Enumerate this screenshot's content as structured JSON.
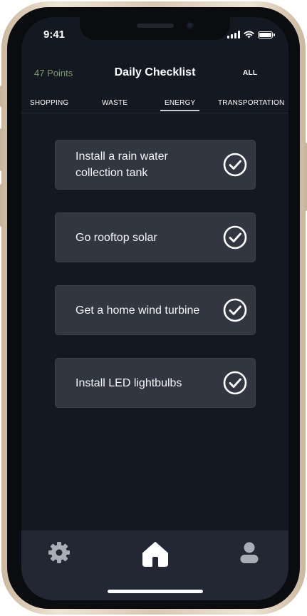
{
  "status_bar": {
    "time": "9:41"
  },
  "header": {
    "points": "47 Points",
    "title": "Daily Checklist",
    "all_label": "ALL"
  },
  "tabs": [
    {
      "label": "SHOPPING",
      "active": false
    },
    {
      "label": "WASTE",
      "active": false
    },
    {
      "label": "ENERGY",
      "active": true
    },
    {
      "label": "TRANSPORTATION",
      "active": false
    }
  ],
  "checklist": [
    {
      "label": "Install a rain water collection tank",
      "icon": "check-circle-icon"
    },
    {
      "label": "Go rooftop solar",
      "icon": "check-circle-icon"
    },
    {
      "label": "Get a home wind turbine",
      "icon": "check-circle-icon"
    },
    {
      "label": "Install LED lightbulbs",
      "icon": "check-circle-icon"
    }
  ],
  "bottom_nav": [
    {
      "icon": "gear-icon"
    },
    {
      "icon": "home-icon"
    },
    {
      "icon": "person-icon"
    }
  ],
  "colors": {
    "background": "#141821",
    "card": "#313640",
    "nav": "#222733",
    "points": "#7f9a6a"
  }
}
